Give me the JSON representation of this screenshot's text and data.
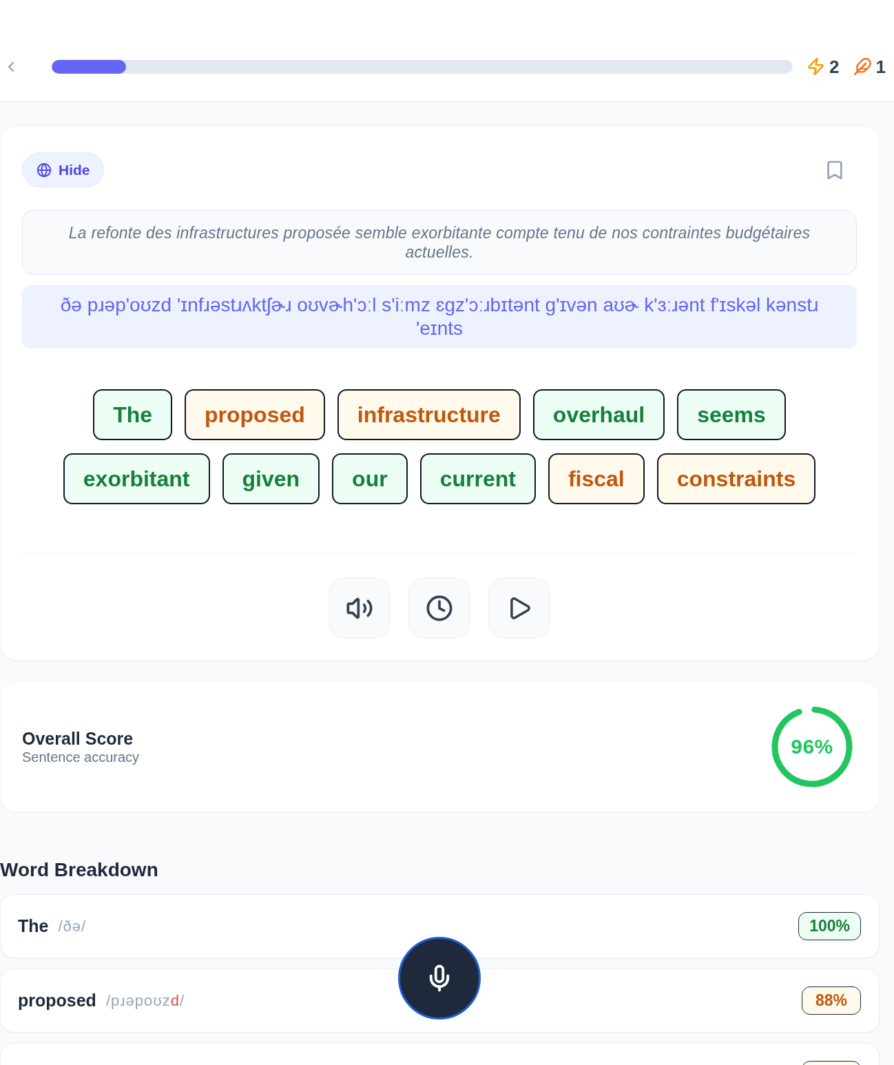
{
  "header": {
    "progress": {
      "level": 0.1
    },
    "stats": [
      {
        "kind": "streak",
        "count": "2"
      },
      {
        "kind": "feather",
        "count": "1"
      }
    ]
  },
  "lesson_card": {
    "translation_toggle": {
      "label": "Hide"
    },
    "bookmarked": false,
    "translation": "La refonte des infrastructures proposée semble exorbitante compte tenu de nos contraintes budgétaires actuelles.",
    "ipa": "ðə pɹəp'oʊzd 'ɪnfɹəstɹʌktʃɚɹ oʊvɚh'ɔːl s'iːmz ɛɡz'ɔːɹbɪtənt ɡ'ɪvən aʊɚ k'ɜːɹənt f'ɪskəl kənstɹ 'eɪnts",
    "word_rows": [
      [
        {
          "text": "The",
          "color": "#15803d"
        },
        {
          "text": "proposed",
          "color": "#c2560c"
        },
        {
          "text": "infrastructure",
          "color": "#c2560c"
        },
        {
          "text": "overhaul",
          "color": "#15803d"
        },
        {
          "text": "seems",
          "color": "#15803d"
        }
      ],
      [
        {
          "text": "exorbitant",
          "color": "#15803d"
        },
        {
          "text": "given",
          "color": "#15803d"
        },
        {
          "text": "our",
          "color": "#15803d"
        },
        {
          "text": "current",
          "color": "#15803d"
        },
        {
          "text": "fiscal",
          "color": "#c2560c"
        },
        {
          "text": "constraints",
          "color": "#c2560c"
        }
      ]
    ],
    "controls": [
      {
        "kind": "speaker"
      },
      {
        "kind": "history"
      },
      {
        "kind": "play"
      }
    ]
  },
  "overall_score": {
    "title": "Overall Score",
    "subtitle": "Sentence accuracy",
    "level": 0.96,
    "value": "96%"
  },
  "word_breakdown": {
    "title": "Word Breakdown",
    "rows": [
      {
        "word": "The",
        "ipa": [
          {
            "text": "/ðə/",
            "error": false
          }
        ],
        "score": "100%",
        "color": "#ecfdf3"
      },
      {
        "word": "proposed",
        "ipa": [
          {
            "text": "/pɹəpoʊz",
            "error": false
          },
          {
            "text": "d",
            "error": true
          },
          {
            "text": "/",
            "error": false
          }
        ],
        "score": "88%",
        "color": "#fffaeb"
      },
      {
        "color": "#fffaeb"
      }
    ]
  },
  "mic_button": {
    "kind": "microphone"
  }
}
